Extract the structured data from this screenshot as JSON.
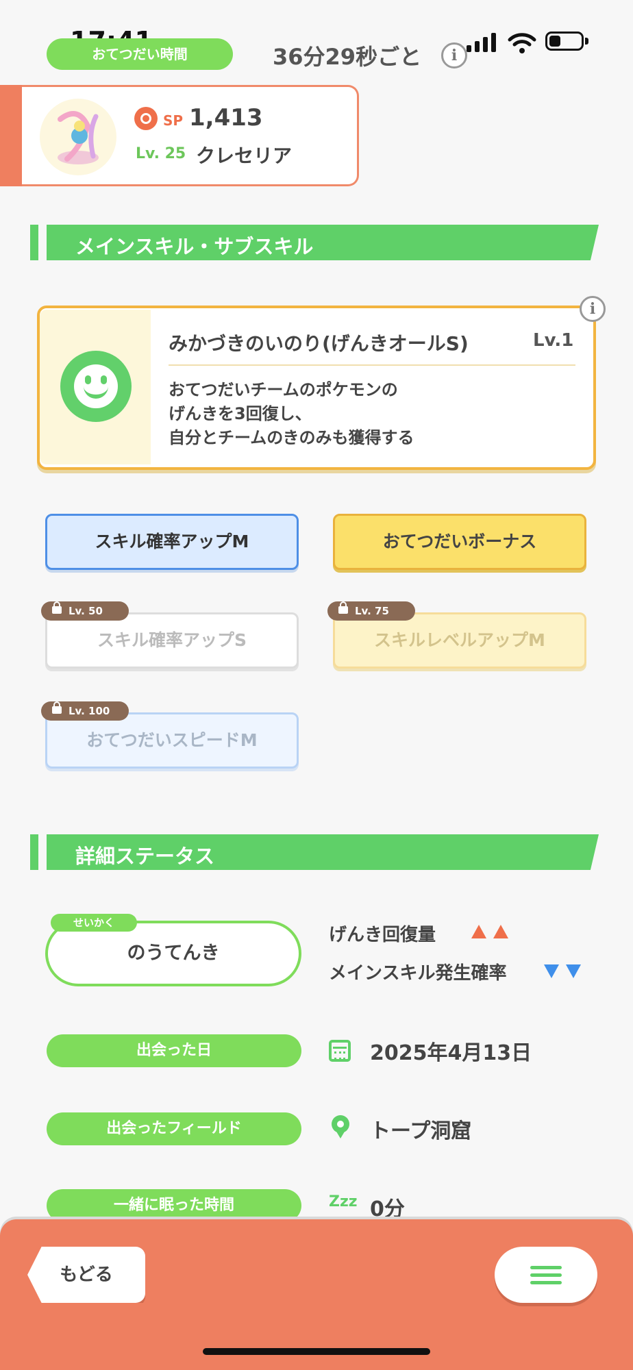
{
  "status_bar": {
    "time": "17:41"
  },
  "header": {
    "help_time_label": "おてつだい時間",
    "help_interval": "36分29秒ごと",
    "info_glyph": "i"
  },
  "pokemon": {
    "sp_label": "SP",
    "sp_value": "1,413",
    "level": "Lv. 25",
    "name": "クレセリア"
  },
  "skills_section": {
    "title": "メインスキル・サブスキル",
    "main_skill": {
      "name": "みかづきのいのり(げんきオールS)",
      "level": "Lv.1",
      "description": [
        "おてつだいチームのポケモンの",
        "げんきを3回復し、",
        "自分とチームのきのみも獲得する"
      ]
    },
    "sub_skills": [
      {
        "name": "スキル確率アップM",
        "locked": false
      },
      {
        "name": "おてつだいボーナス",
        "locked": false
      },
      {
        "name": "スキル確率アップS",
        "unlock_level": "Lv. 50",
        "locked": true
      },
      {
        "name": "スキルレベルアップM",
        "unlock_level": "Lv. 75",
        "locked": true
      },
      {
        "name": "おてつだいスピードM",
        "unlock_level": "Lv. 100",
        "locked": true
      }
    ]
  },
  "details_section": {
    "title": "詳細ステータス",
    "nature_label": "せいかく",
    "nature": "のうてんき",
    "nature_up": "げんき回復量",
    "nature_down": "メインスキル発生確率",
    "met_date_label": "出会った日",
    "met_date": "2025年4月13日",
    "met_field_label": "出会ったフィールド",
    "met_field": "トープ洞窟",
    "slept_label": "一緒に眠った時間",
    "slept_icon": "Zzz",
    "slept_value": "0分"
  },
  "footer": {
    "back_label": "もどる"
  },
  "colors": {
    "accent_green": "#5fd068",
    "footer_orange": "#ee7f60",
    "stat_up": "#ef6f4a",
    "stat_down": "#3f8fea"
  }
}
